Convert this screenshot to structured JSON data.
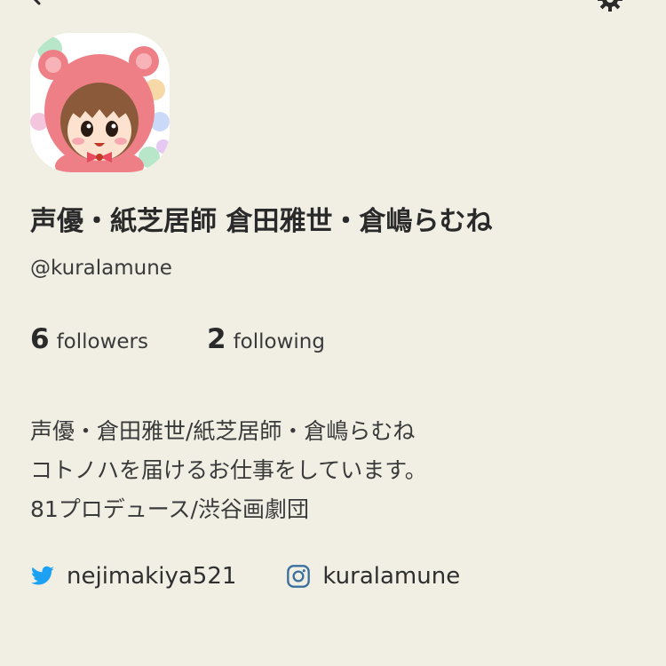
{
  "header": {
    "back_icon": "back-arrow-icon",
    "settings_icon": "gear-icon"
  },
  "profile": {
    "avatar_icon": "avatar-image",
    "display_name": "声優・紙芝居師 倉田雅世・倉嶋らむね",
    "username": "@kuralamune"
  },
  "stats": {
    "followers_count": "6",
    "followers_label": "followers",
    "following_count": "2",
    "following_label": "following"
  },
  "bio": {
    "lines": [
      "声優・倉田雅世/紙芝居師・倉嶋らむね",
      "コトノハを届けるお仕事をしています。",
      "81プロデュース/渋谷画劇団"
    ]
  },
  "social": {
    "twitter_handle": "nejimakiya521",
    "twitter_icon": "twitter-icon",
    "instagram_handle": "kuralamune",
    "instagram_icon": "instagram-icon"
  },
  "colors": {
    "background": "#f1efe4",
    "text_primary": "#2a2a2a",
    "twitter_blue": "#1da1f2",
    "instagram_blue": "#3b6f9e"
  }
}
